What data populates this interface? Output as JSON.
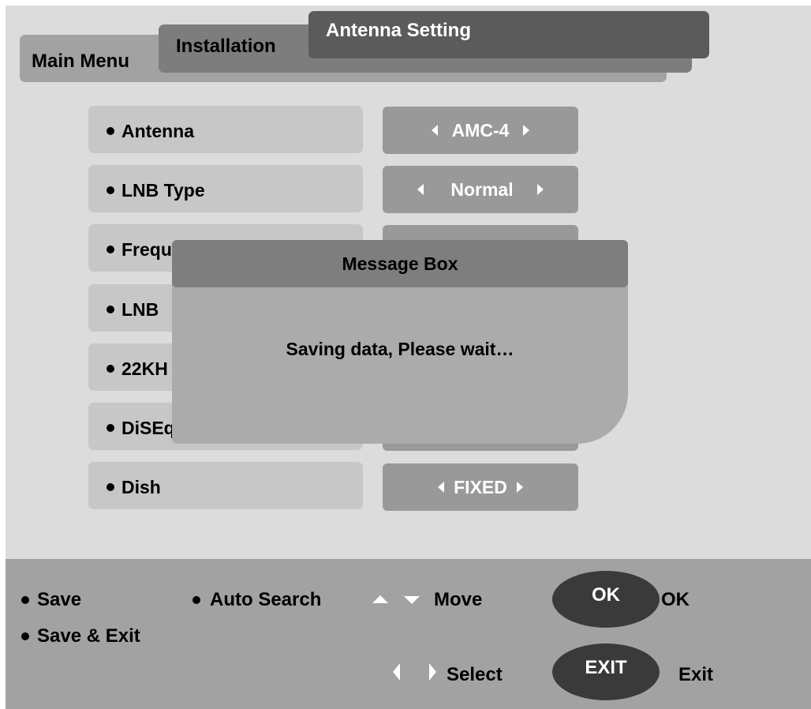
{
  "tabs": {
    "main_menu": "Main Menu",
    "installation": "Installation",
    "antenna_setting": "Antenna Setting"
  },
  "settings": [
    {
      "label": "Antenna",
      "value": "AMC-4"
    },
    {
      "label": "LNB Type",
      "value": "Normal"
    },
    {
      "label": "Frequ",
      "value": ""
    },
    {
      "label": "LNB",
      "value": ""
    },
    {
      "label": "22KH",
      "value": ""
    },
    {
      "label": "DiSEq",
      "value": ""
    },
    {
      "label": "Dish",
      "value": "FIXED"
    }
  ],
  "message_box": {
    "title": "Message Box",
    "text": "Saving data, Please wait…"
  },
  "footer": {
    "save": "Save",
    "auto_search": "Auto Search",
    "move": "Move",
    "ok_button": "OK",
    "ok_label": "OK",
    "save_exit": "Save & Exit",
    "exit_button": "EXIT",
    "exit_label": "Exit",
    "select": "Select"
  }
}
